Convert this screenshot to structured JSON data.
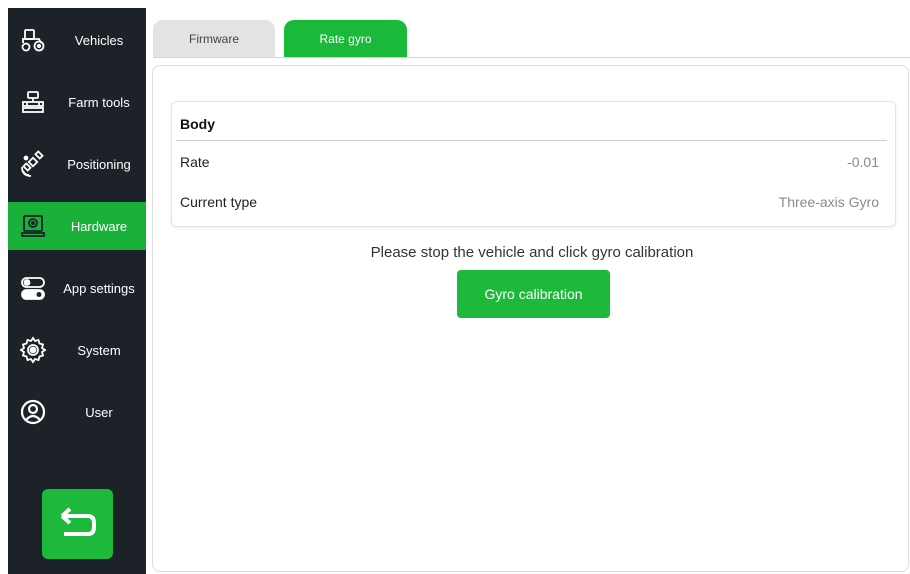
{
  "sidebar": {
    "items": [
      {
        "label": "Vehicles",
        "icon": "tractor-icon"
      },
      {
        "label": "Farm tools",
        "icon": "farm-tool-icon"
      },
      {
        "label": "Positioning",
        "icon": "satellite-icon"
      },
      {
        "label": "Hardware",
        "icon": "hardware-icon",
        "active": true
      },
      {
        "label": "App settings",
        "icon": "toggle-icon"
      },
      {
        "label": "System",
        "icon": "gear-icon"
      },
      {
        "label": "User",
        "icon": "user-icon"
      }
    ],
    "back_icon": "back-arrow-icon"
  },
  "tabs": [
    {
      "label": "Firmware",
      "active": false
    },
    {
      "label": "Rate gyro",
      "active": true
    }
  ],
  "card": {
    "title": "Body",
    "rows": [
      {
        "label": "Rate",
        "value": "-0.01"
      },
      {
        "label": "Current type",
        "value": "Three-axis Gyro"
      }
    ]
  },
  "prompt": "Please stop the vehicle and click gyro calibration",
  "calibration_button": "Gyro calibration",
  "colors": {
    "accent": "#1db93a",
    "sidebar_bg": "#1c2228",
    "tab_inactive": "#e3e3e3"
  }
}
